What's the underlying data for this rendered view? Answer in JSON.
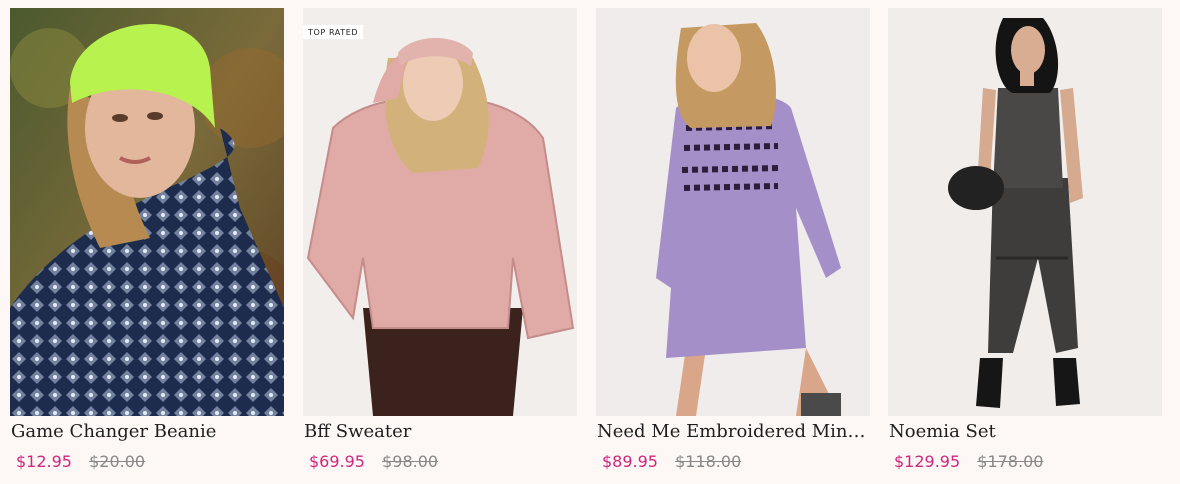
{
  "colors": {
    "background": "#fdf8f6",
    "sale_price": "#d0267d",
    "original_price": "#888888"
  },
  "products": [
    {
      "name": "Game Changer Beanie",
      "badge": "",
      "sale_price": "$12.95",
      "original_price": "$20.00",
      "image_subject": "model in neon green beanie and blue printed puffer jacket"
    },
    {
      "name": "Bff Sweater",
      "badge": "TOP RATED",
      "sale_price": "$69.95",
      "original_price": "$98.00",
      "image_subject": "model in pink boucle sweater, headband and dark brown pants"
    },
    {
      "name": "Need Me Embroidered Mini D...",
      "badge": "",
      "sale_price": "$89.95",
      "original_price": "$118.00",
      "image_subject": "model in lilac embroidered mini dress"
    },
    {
      "name": "Noemia Set",
      "badge": "",
      "sale_price": "$129.95",
      "original_price": "$178.00",
      "image_subject": "model in charcoal tank and tie-waist harem pants with black bag"
    }
  ]
}
